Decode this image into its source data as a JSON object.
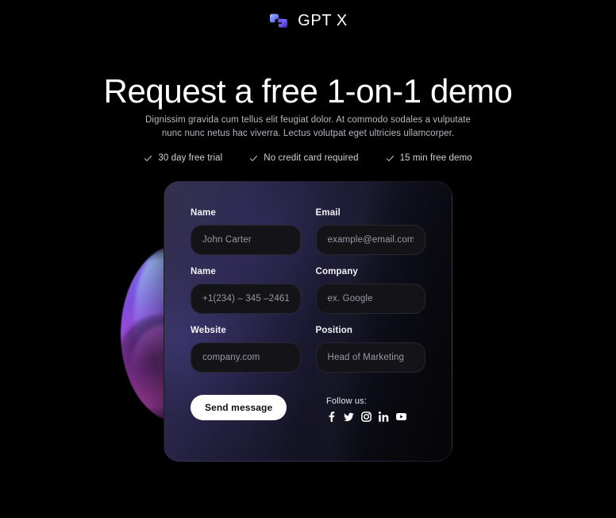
{
  "brand": {
    "logo_icon": "gptx-logo-icon",
    "name": "GPT X",
    "accent_color_start": "#7ea7ff",
    "accent_color_end": "#5b3fd6"
  },
  "hero": {
    "headline": "Request a free 1-on-1 demo",
    "subtitle": "Dignissim gravida cum tellus elit feugiat dolor. At commodo sodales a vulputate nunc nunc netus hac viverra. Lectus volutpat eget ultricies ullamcorper.",
    "features": [
      {
        "icon": "check-icon",
        "label": "30 day free trial"
      },
      {
        "icon": "check-icon",
        "label": "No credit card required"
      },
      {
        "icon": "check-icon",
        "label": "15 min free demo"
      }
    ]
  },
  "form": {
    "fields": [
      {
        "label": "Name",
        "placeholder": "John Carter",
        "value": ""
      },
      {
        "label": "Email",
        "placeholder": "example@email.com",
        "value": ""
      },
      {
        "label": "Name",
        "placeholder": "+1(234) – 345 –2461",
        "value": ""
      },
      {
        "label": "Company",
        "placeholder": "ex. Google",
        "value": ""
      },
      {
        "label": "Website",
        "placeholder": "company.com",
        "value": ""
      },
      {
        "label": "Position",
        "placeholder": "Head of Marketing",
        "value": ""
      }
    ],
    "submit_label": "Send message"
  },
  "social": {
    "label": "Follow us:",
    "links": [
      {
        "icon": "facebook-icon",
        "name": "Facebook"
      },
      {
        "icon": "twitter-icon",
        "name": "Twitter"
      },
      {
        "icon": "instagram-icon",
        "name": "Instagram"
      },
      {
        "icon": "linkedin-icon",
        "name": "LinkedIn"
      },
      {
        "icon": "youtube-icon",
        "name": "YouTube"
      }
    ]
  },
  "decor": {
    "orb_name": "gradient-orb-decoration"
  },
  "theme": {
    "background": "#000000",
    "card_gradient_from": "#2a2744",
    "card_gradient_to": "#050508",
    "input_background": "#131318",
    "button_background": "#ffffff",
    "text_primary": "#ffffff",
    "text_muted": "#9a9aa6"
  }
}
